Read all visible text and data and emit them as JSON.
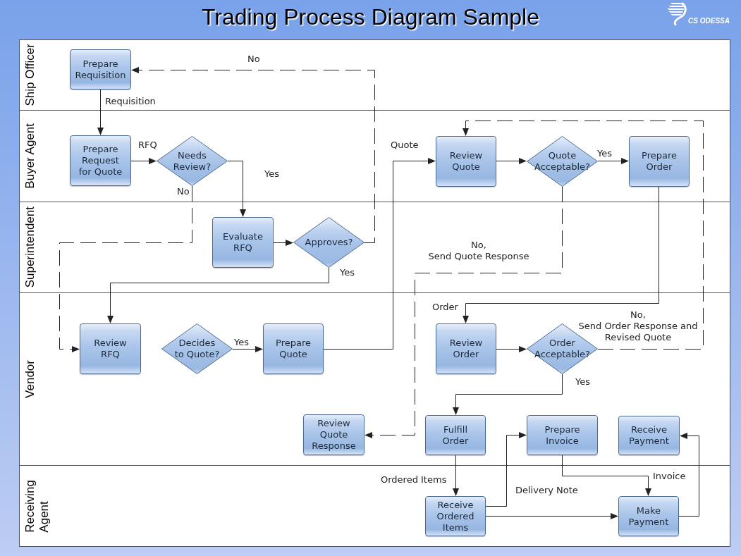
{
  "title": "Trading Process Diagram Sample",
  "logo": {
    "text": "CS ODESSA"
  },
  "lanes": [
    {
      "label": "Ship Officer"
    },
    {
      "label": "Buyer Agent"
    },
    {
      "label": "Superintendent"
    },
    {
      "label": "Vendor"
    },
    {
      "label": "Receiving\nAgent"
    }
  ],
  "nodes": [
    {
      "kind": "process",
      "text": "Prepare\nRequisition"
    },
    {
      "kind": "process",
      "text": "Prepare\nRequest\nfor Quote"
    },
    {
      "kind": "decision",
      "text": "Needs\nReview?"
    },
    {
      "kind": "process",
      "text": "Evaluate\nRFQ"
    },
    {
      "kind": "decision",
      "text": "Approves?"
    },
    {
      "kind": "process",
      "text": "Review\nRFQ"
    },
    {
      "kind": "decision",
      "text": "Decides\nto Quote?"
    },
    {
      "kind": "process",
      "text": "Prepare\nQuote"
    },
    {
      "kind": "process",
      "text": "Review\nQuote\nResponse"
    },
    {
      "kind": "process",
      "text": "Review\nQuote"
    },
    {
      "kind": "decision",
      "text": "Quote\nAcceptable?"
    },
    {
      "kind": "process",
      "text": "Prepare\nOrder"
    },
    {
      "kind": "process",
      "text": "Review\nOrder"
    },
    {
      "kind": "decision",
      "text": "Order\nAcceptable?"
    },
    {
      "kind": "process",
      "text": "Fulfill\nOrder"
    },
    {
      "kind": "process",
      "text": "Prepare\nInvoice"
    },
    {
      "kind": "process",
      "text": "Receive\nPayment"
    },
    {
      "kind": "process",
      "text": "Receive\nOrdered\nItems"
    },
    {
      "kind": "process",
      "text": "Make\nPayment"
    }
  ],
  "connectors": [
    {
      "kind": "solid",
      "label": "Requisition"
    },
    {
      "kind": "solid",
      "label": "RFQ"
    },
    {
      "kind": "solid",
      "label": "Yes"
    },
    {
      "kind": "dashed",
      "label": "No"
    },
    {
      "kind": "solid"
    },
    {
      "kind": "dashed",
      "label": "No"
    },
    {
      "kind": "solid",
      "label": "Yes"
    },
    {
      "kind": "solid",
      "label": "Yes"
    },
    {
      "kind": "solid",
      "label": "Quote"
    },
    {
      "kind": "solid"
    },
    {
      "kind": "solid",
      "label": "Yes"
    },
    {
      "kind": "dashed",
      "label": "No,\nSend Quote Response"
    },
    {
      "kind": "solid",
      "label": "Order"
    },
    {
      "kind": "solid"
    },
    {
      "kind": "dashed",
      "label": "No,\nSend Order Response and\nRevised Quote"
    },
    {
      "kind": "solid",
      "label": "Yes"
    },
    {
      "kind": "solid",
      "label": "Ordered Items"
    },
    {
      "kind": "solid",
      "label": "Delivery Note"
    },
    {
      "kind": "solid"
    },
    {
      "kind": "solid",
      "label": "Invoice"
    },
    {
      "kind": "solid"
    }
  ]
}
